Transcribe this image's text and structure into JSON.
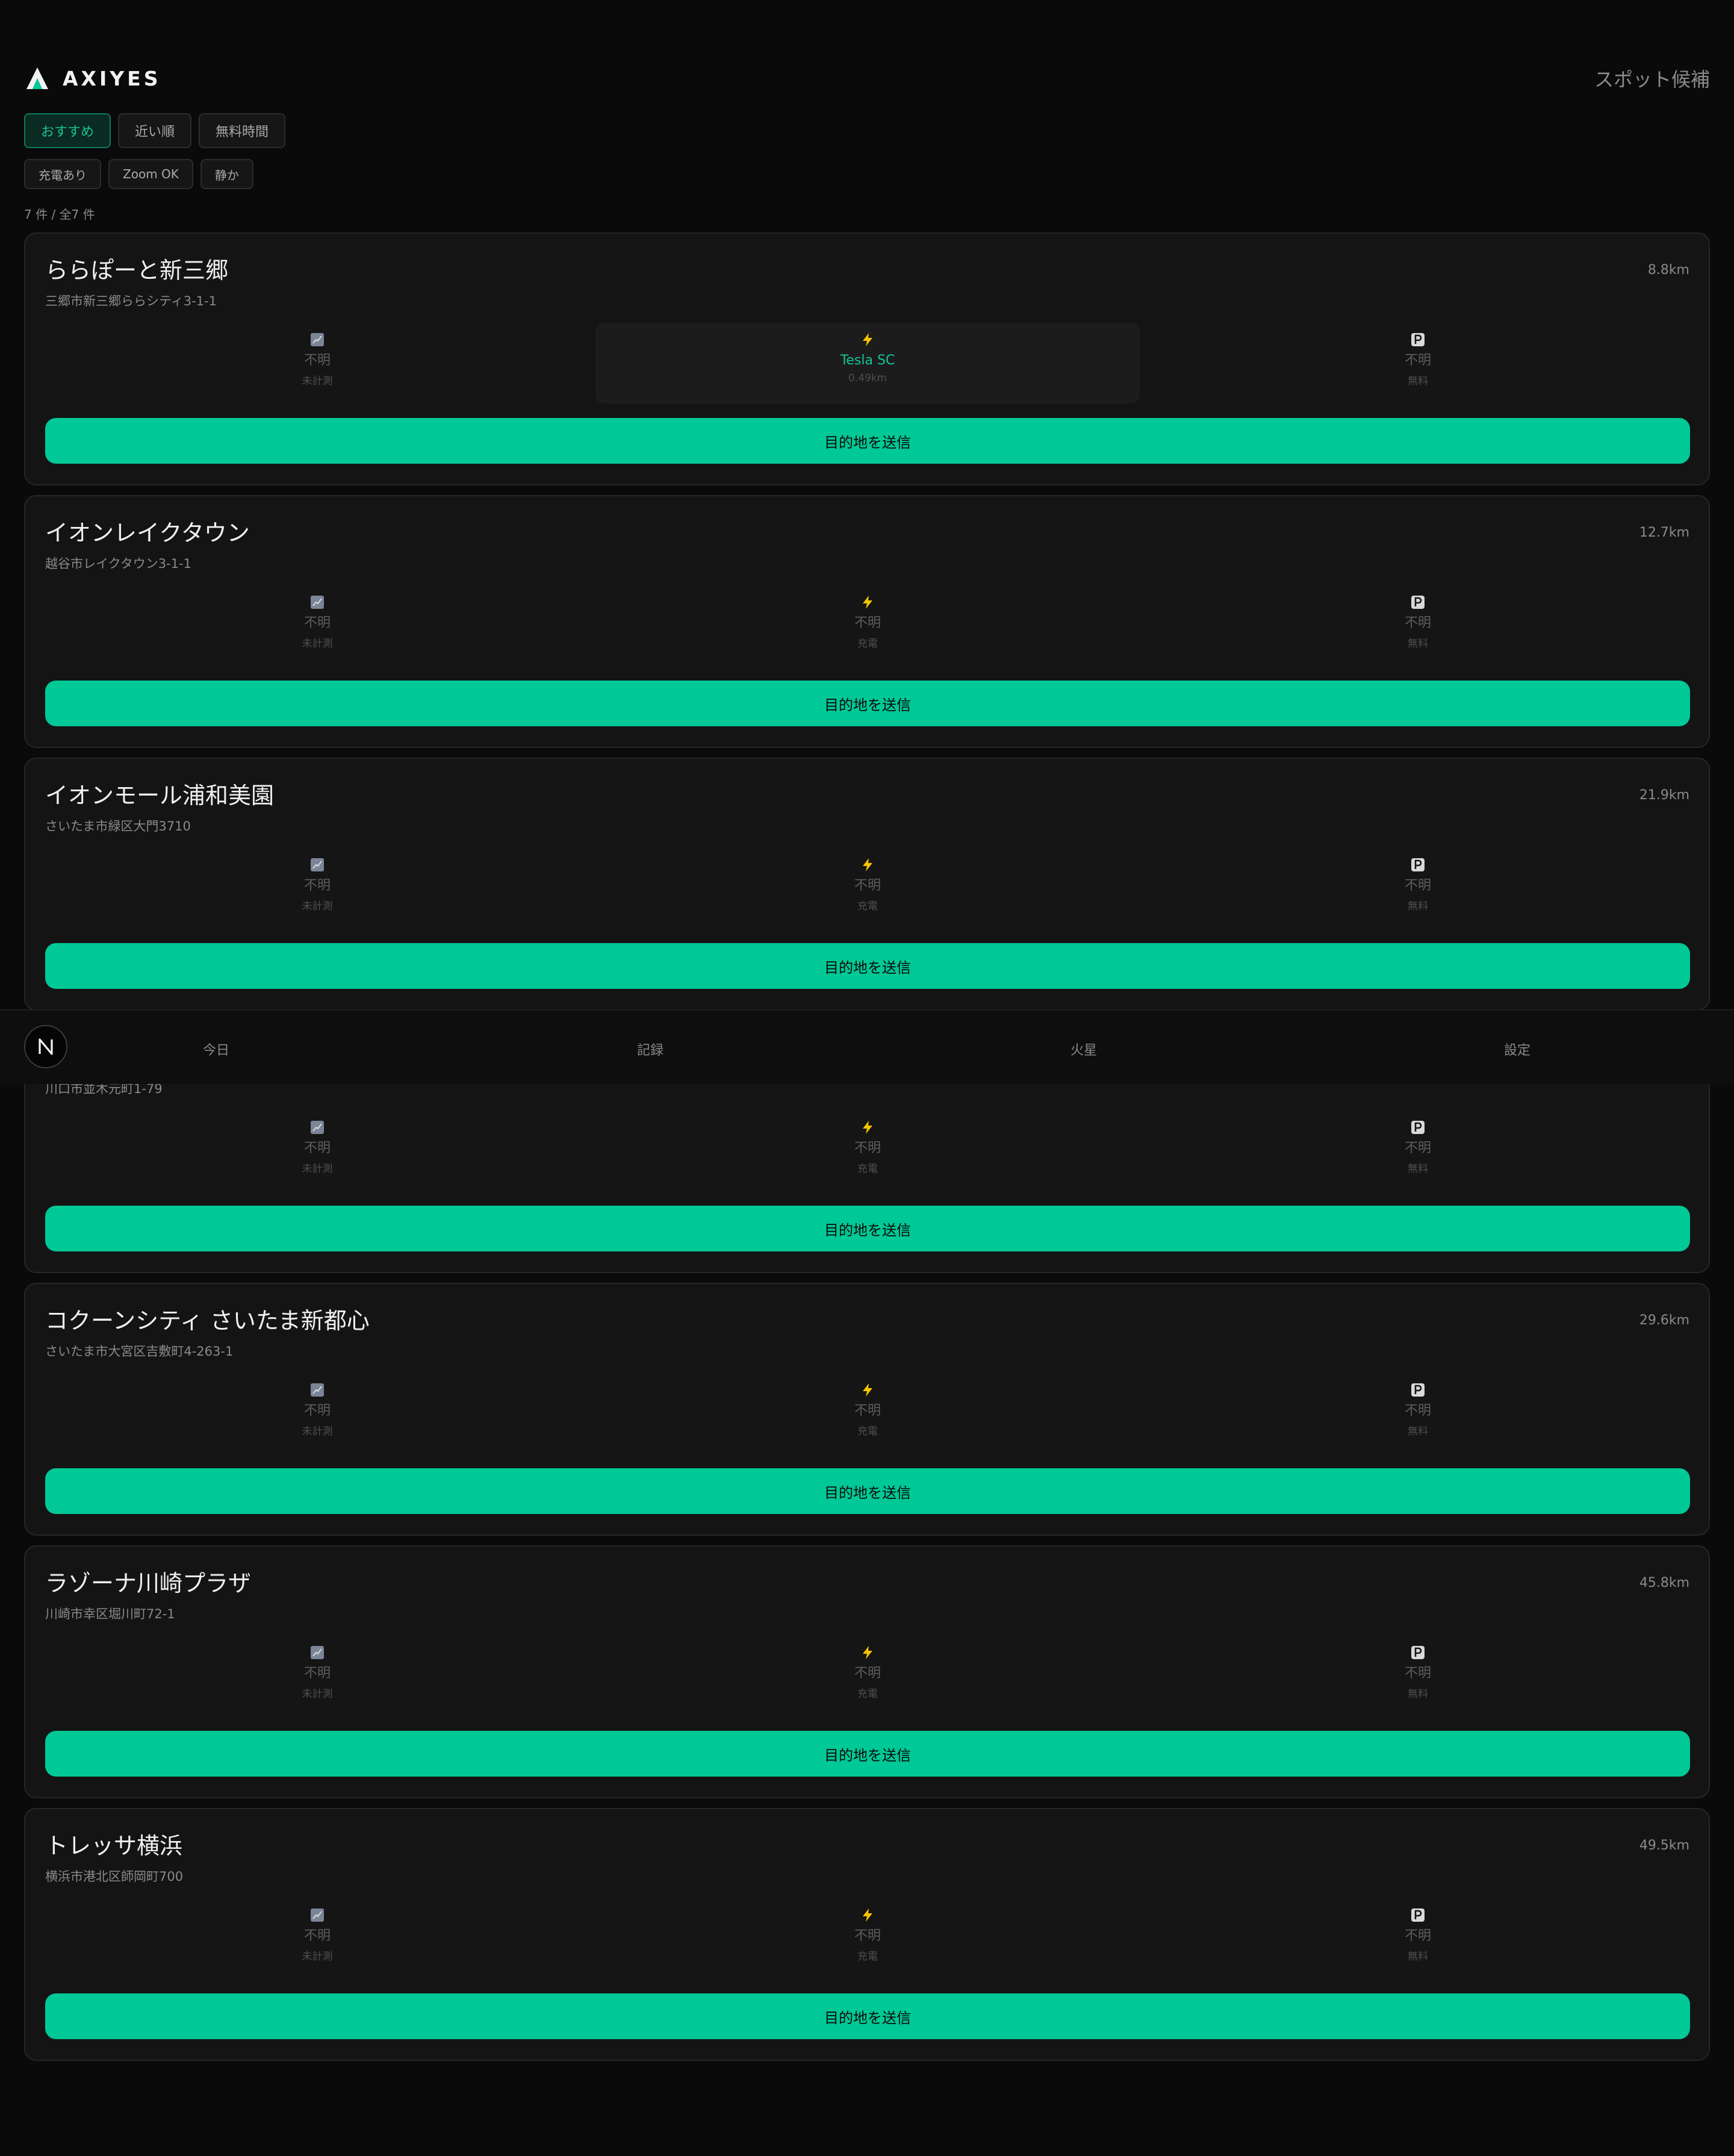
{
  "header": {
    "brand": "AXIYES",
    "right_label": "スポット候補"
  },
  "sort_chips": [
    {
      "label": "おすすめ",
      "active": true
    },
    {
      "label": "近い順",
      "active": false
    },
    {
      "label": "無料時間",
      "active": false
    }
  ],
  "filter_chips": [
    {
      "label": "充電あり"
    },
    {
      "label": "Zoom OK"
    },
    {
      "label": "静か"
    }
  ],
  "count_text": "7 件 / 全7 件",
  "send_label": "目的地を送信",
  "spots": [
    {
      "name": "ららぽーと新三郷",
      "distance": "8.8km",
      "address": "三郷市新三郷ららシティ3-1-1",
      "stats": [
        {
          "icon": "signal-icon",
          "value": "不明",
          "sub": "未計測"
        },
        {
          "icon": "bolt-icon",
          "value": "Tesla SC",
          "sub": "0.49km",
          "highlight": true
        },
        {
          "icon": "parking-icon",
          "value": "不明",
          "sub": "無料"
        }
      ]
    },
    {
      "name": "イオンレイクタウン",
      "distance": "12.7km",
      "address": "越谷市レイクタウン3-1-1",
      "stats": [
        {
          "icon": "signal-icon",
          "value": "不明",
          "sub": "未計測"
        },
        {
          "icon": "bolt-icon",
          "value": "不明",
          "sub": "充電"
        },
        {
          "icon": "parking-icon",
          "value": "不明",
          "sub": "無料"
        }
      ]
    },
    {
      "name": "イオンモール浦和美園",
      "distance": "21.9km",
      "address": "さいたま市緑区大門3710",
      "stats": [
        {
          "icon": "signal-icon",
          "value": "不明",
          "sub": "未計測"
        },
        {
          "icon": "bolt-icon",
          "value": "不明",
          "sub": "充電"
        },
        {
          "icon": "parking-icon",
          "value": "不明",
          "sub": "無料"
        }
      ]
    },
    {
      "name": "",
      "distance": "",
      "address": "川口市並木元町1-79",
      "stats": [
        {
          "icon": "signal-icon",
          "value": "不明",
          "sub": "未計測"
        },
        {
          "icon": "bolt-icon",
          "value": "不明",
          "sub": "充電"
        },
        {
          "icon": "parking-icon",
          "value": "不明",
          "sub": "無料"
        }
      ]
    },
    {
      "name": "コクーンシティ さいたま新都心",
      "distance": "29.6km",
      "address": "さいたま市大宮区吉敷町4-263-1",
      "stats": [
        {
          "icon": "signal-icon",
          "value": "不明",
          "sub": "未計測"
        },
        {
          "icon": "bolt-icon",
          "value": "不明",
          "sub": "充電"
        },
        {
          "icon": "parking-icon",
          "value": "不明",
          "sub": "無料"
        }
      ]
    },
    {
      "name": "ラゾーナ川崎プラザ",
      "distance": "45.8km",
      "address": "川崎市幸区堀川町72-1",
      "stats": [
        {
          "icon": "signal-icon",
          "value": "不明",
          "sub": "未計測"
        },
        {
          "icon": "bolt-icon",
          "value": "不明",
          "sub": "充電"
        },
        {
          "icon": "parking-icon",
          "value": "不明",
          "sub": "無料"
        }
      ]
    },
    {
      "name": "トレッサ横浜",
      "distance": "49.5km",
      "address": "横浜市港北区師岡町700",
      "stats": [
        {
          "icon": "signal-icon",
          "value": "不明",
          "sub": "未計測"
        },
        {
          "icon": "bolt-icon",
          "value": "不明",
          "sub": "充電"
        },
        {
          "icon": "parking-icon",
          "value": "不明",
          "sub": "無料"
        }
      ]
    }
  ],
  "nav": {
    "logo_letter": "N",
    "items": [
      "今日",
      "記録",
      "火星",
      "設定"
    ]
  },
  "colors": {
    "accent": "#00c896",
    "accent_text": "#16c596",
    "background": "#0a0a0a",
    "card": "#141414"
  }
}
